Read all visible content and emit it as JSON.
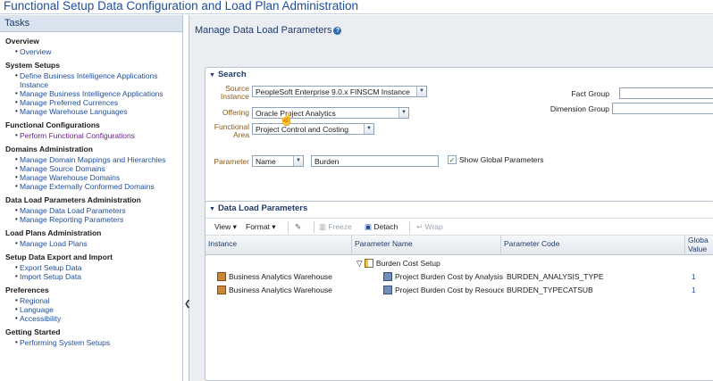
{
  "title": "Functional Setup Data Configuration and Load Plan Administration",
  "tasks": {
    "header": "Tasks",
    "sections": [
      {
        "heading": "Overview",
        "items": [
          {
            "label": "Overview"
          }
        ]
      },
      {
        "heading": "System Setups",
        "items": [
          {
            "label": "Define Business Intelligence Applications",
            "cont": "Instance"
          },
          {
            "label": "Manage Business Intelligence Applications"
          },
          {
            "label": "Manage Preferred Currences"
          },
          {
            "label": "Manage Warehouse Languages"
          }
        ]
      },
      {
        "heading": "Functional Configurations",
        "items": [
          {
            "label": "Perform Functional Configurations"
          }
        ]
      },
      {
        "heading": "Domains Administration",
        "items": [
          {
            "label": "Manage Domain Mappings and Hierarchies"
          },
          {
            "label": "Manage Source Domains"
          },
          {
            "label": "Manage Warehouse Domains"
          },
          {
            "label": "Manage Externally Conformed Domains"
          }
        ]
      },
      {
        "heading": "Data Load Parameters Administration",
        "items": [
          {
            "label": "Manage Data Load Parameters"
          },
          {
            "label": "Manage Reporting Parameters"
          }
        ]
      },
      {
        "heading": "Load Plans Administration",
        "items": [
          {
            "label": "Manage Load Plans"
          }
        ]
      },
      {
        "heading": "Setup Data Export and Import",
        "items": [
          {
            "label": "Export Setup Data"
          },
          {
            "label": "Import Setup Data"
          }
        ]
      },
      {
        "heading": "Preferences",
        "items": [
          {
            "label": "Regional"
          },
          {
            "label": "Language"
          },
          {
            "label": "Accessibility"
          }
        ]
      },
      {
        "heading": "Getting Started",
        "items": [
          {
            "label": "Performing System Setups"
          }
        ]
      }
    ]
  },
  "main": {
    "title": "Manage Data Load Parameters",
    "help_glyph": "?",
    "search": {
      "header": "Search",
      "source_instance_label_1": "Source",
      "source_instance_label_2": "Instance",
      "source_instance_value": "PeopleSoft Enterprise 9.0.x FINSCM Instance",
      "offering_label": "Offering",
      "offering_value": "Oracle Project Analytics",
      "functional_area_label_1": "Functional",
      "functional_area_label_2": "Area",
      "functional_area_value": "Project Control and Costing",
      "parameter_label": "Parameter",
      "parameter_type_value": "Name",
      "parameter_value": "Burden",
      "show_global_label": "Show Global Parameters",
      "show_global_checked": true,
      "fact_group_label": "Fact Group",
      "dimension_group_label": "Dimension Group"
    },
    "dlp": {
      "header": "Data Load Parameters",
      "toolbar": {
        "view": "View",
        "format": "Format",
        "freeze": "Freeze",
        "detach": "Detach",
        "wrap": "Wrap"
      },
      "columns": [
        "Instance",
        "Parameter Name",
        "Parameter Code",
        "Globa",
        "Value"
      ],
      "group_row": "Burden Cost Setup",
      "rows": [
        {
          "instance": "Business Analytics Warehouse",
          "name": "Project Burden Cost by Analysis",
          "code": "BURDEN_ANALYSIS_TYPE",
          "global": "1"
        },
        {
          "instance": "Business Analytics Warehouse",
          "name": "Project Burden Cost by Resouce",
          "code": "BURDEN_TYPECATSUB",
          "global": "1"
        }
      ]
    }
  },
  "colors": {
    "accent": "#1f4e9c",
    "panel_bg": "#eaeef2",
    "visited": "#6a1f8a"
  }
}
